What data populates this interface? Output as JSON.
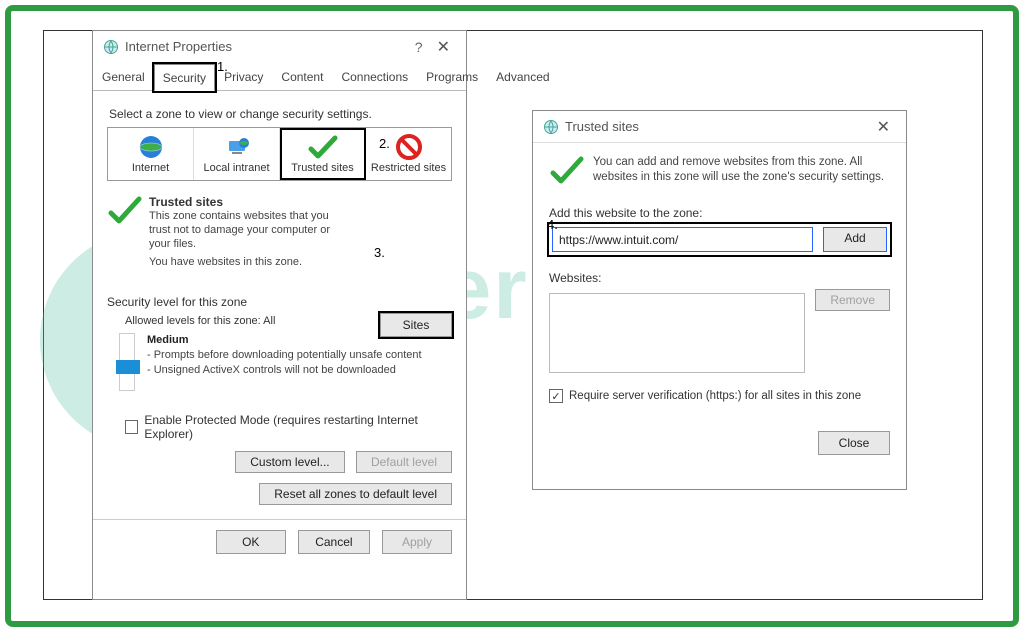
{
  "watermark": "eBetterBooks",
  "annotations": {
    "a1": "1.",
    "a2": "2.",
    "a3": "3.",
    "a4": "4."
  },
  "dialog1": {
    "title": "Internet Properties",
    "tabs": [
      "General",
      "Security",
      "Privacy",
      "Content",
      "Connections",
      "Programs",
      "Advanced"
    ],
    "active_tab_index": 1,
    "zone_instruction": "Select a zone to view or change security settings.",
    "zones": [
      {
        "label": "Internet"
      },
      {
        "label": "Local intranet"
      },
      {
        "label": "Trusted sites"
      },
      {
        "label": "Restricted sites"
      }
    ],
    "selected_zone_index": 2,
    "zone_title": "Trusted sites",
    "zone_desc_1": "This zone contains websites that you trust not to damage your computer or your files.",
    "zone_desc_2": "You have websites in this zone.",
    "sites_btn": "Sites",
    "sec_header": "Security level for this zone",
    "allowed_line": "Allowed levels for this zone: All",
    "level_name": "Medium",
    "level_line_1": "- Prompts before downloading potentially unsafe content",
    "level_line_2": "- Unsigned ActiveX controls will not be downloaded",
    "protected_label": "Enable Protected Mode (requires restarting Internet Explorer)",
    "custom_btn": "Custom level...",
    "default_btn": "Default level",
    "reset_btn": "Reset all zones to default level",
    "ok": "OK",
    "cancel": "Cancel",
    "apply": "Apply"
  },
  "dialog2": {
    "title": "Trusted sites",
    "desc": "You can add and remove websites from this zone. All websites in this zone will use the zone's security settings.",
    "add_label": "Add this website to the zone:",
    "url_value": "https://www.intuit.com/",
    "add_btn": "Add",
    "websites_label": "Websites:",
    "remove_btn": "Remove",
    "require_label": "Require server verification (https:) for all sites in this zone",
    "close_btn": "Close"
  }
}
